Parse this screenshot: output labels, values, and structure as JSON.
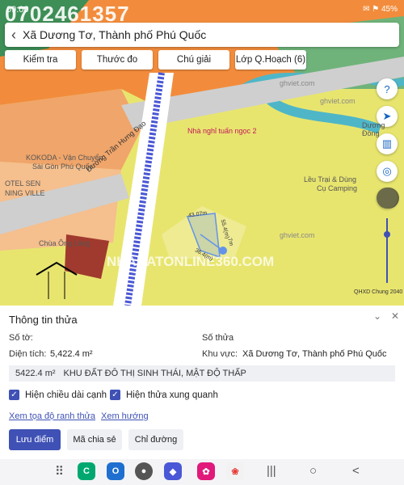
{
  "status_bar": {
    "time": "09:00",
    "watermark_phone": "0702461357",
    "icons_text": "✉ ⚑ 45%"
  },
  "search": {
    "back_icon": "chevron-left-icon",
    "text": "Xã Dương Tơ, Thành phố Phú Quốc"
  },
  "toolbar": {
    "items": [
      {
        "label": "Kiểm tra"
      },
      {
        "label": "Thước đo"
      },
      {
        "label": "Chú giải"
      },
      {
        "label": "Lớp Q.Hoạch (6)"
      }
    ]
  },
  "map": {
    "labels": {
      "nha_nghi": "Nhà nghỉ tuấn ngọc 2",
      "kokoda": "KOKODA - Vận Chuyển",
      "saigon": "Sài Gòn Phú Quốc",
      "hotel": "OTEL SEN",
      "ning_ville": "NING VILLE",
      "road": "Đường Trần Hưng Đạo",
      "chua": "Chùa Ông Lăng",
      "leu_trai": "Lều Trại & Dùng",
      "cu_camping": "Cụ Camping",
      "ghviet1": "ghviet.com",
      "ghviet2": "ghviet.com",
      "ghviet3": "ghviet.com",
      "duong_dong": "Dương Đông",
      "qhxd": "QHXD Chung 2040",
      "wm_big": "NHADATONLINE360.COM",
      "dim_top": "43.07m",
      "dim_right": "55.4(m)",
      "dim_right2": "7m",
      "dim_bottom": "36.4(m)"
    },
    "right_buttons": [
      {
        "icon": "help-icon",
        "glyph": "?"
      },
      {
        "icon": "compass-icon",
        "glyph": "➤"
      },
      {
        "icon": "barcode-icon",
        "glyph": "▥"
      },
      {
        "icon": "locate-icon",
        "glyph": "◎"
      }
    ],
    "colors": {
      "yellow": "#e8e56f",
      "orange": "#f28c3c",
      "river": "#4fb6c8",
      "road_blue": "#4a57d6",
      "parcel_red": "#a03a2e",
      "parcel_blue": "#2f6fe0"
    }
  },
  "panel": {
    "title": "Thông tin thửa",
    "so_to_label": "Số tờ:",
    "so_to_value": "",
    "so_thua_label": "Số thửa",
    "so_thua_value": "",
    "dien_tich_label": "Diện tích:",
    "dien_tich_value": "5,422.4 m²",
    "khu_vuc_label": "Khu vực:",
    "khu_vuc_value": "Xã Dương Tơ, Thành phố Phú Quốc",
    "area_box_value": "5422.4 m²",
    "area_box_desc": "KHU ĐẤT ĐÔ THỊ SINH THÁI, MẬT ĐỘ THẤP",
    "check1": "Hiện chiều dài cạnh",
    "check2": "Hiện thửa xung quanh",
    "link1": "Xem tọa độ ranh thửa",
    "link2": "Xem hướng",
    "btn_save": "Lưu điểm",
    "btn_share": "Mã chia sẻ",
    "btn_direction": "Chỉ đường"
  },
  "navbar": {
    "recents": "|||",
    "home": "○",
    "back": "<",
    "apps": [
      "apps-grid-icon",
      "call-app-icon",
      "outlook-icon",
      "camera-icon",
      "maps-icon",
      "flower-app-icon",
      "gallery-icon"
    ]
  }
}
